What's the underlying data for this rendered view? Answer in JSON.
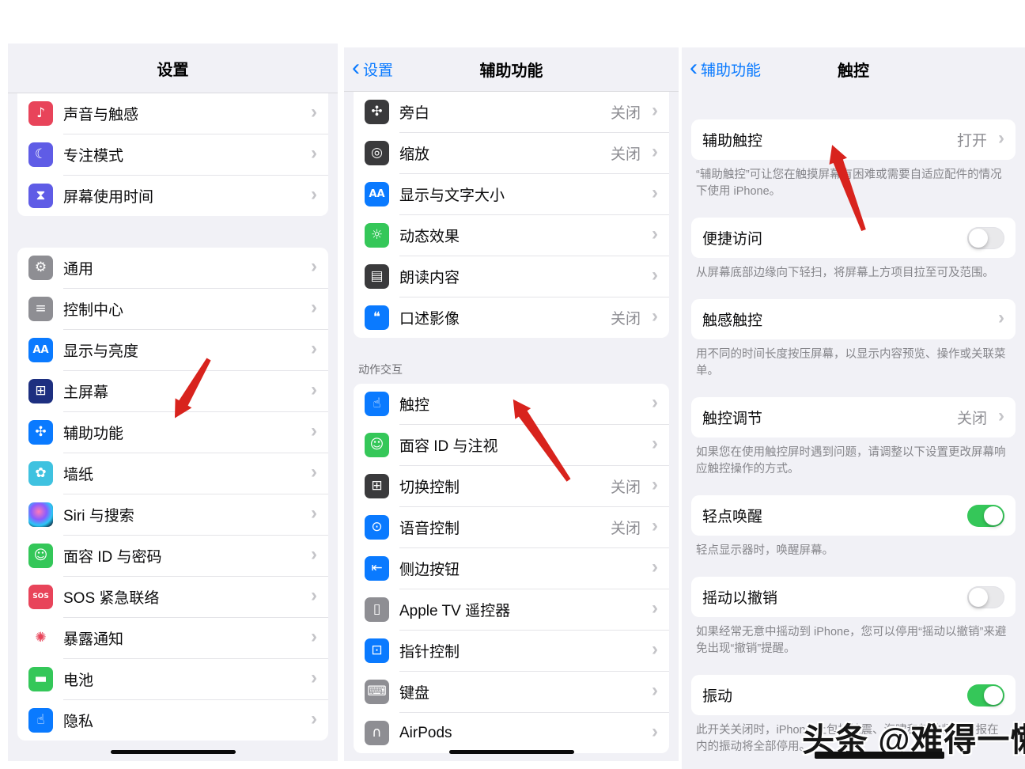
{
  "watermark": {
    "text": "头条 @难得一懒"
  },
  "colors": {
    "accent_blue": "#0a7aff",
    "toggle_on": "#35c759",
    "toggle_off": "#e9e9eb",
    "arrow_red": "#d8231d",
    "panel_bg": "#f1f1f6",
    "card_bg": "#ffffff",
    "value_gray": "#8e8e93"
  },
  "panels": [
    {
      "name": "settings-root",
      "header": {
        "title": "设置"
      },
      "home_indicator": true,
      "sections": [
        {
          "kind": "group",
          "flush": true,
          "items": [
            {
              "name": "sound-haptics",
              "label": "声音与触感",
              "chevron": true,
              "icon": {
                "name": "speaker-icon",
                "glyph": "♪",
                "bg": "#e8445a"
              }
            },
            {
              "name": "focus-mode",
              "label": "专注模式",
              "chevron": true,
              "icon": {
                "name": "moon-icon",
                "glyph": "☾",
                "bg": "#5f5ce6"
              }
            },
            {
              "name": "screen-time",
              "label": "屏幕使用时间",
              "chevron": true,
              "icon": {
                "name": "hourglass-icon",
                "glyph": "⧗",
                "bg": "#5f5ce6"
              }
            }
          ]
        },
        {
          "kind": "group",
          "items": [
            {
              "name": "general",
              "label": "通用",
              "chevron": true,
              "icon": {
                "name": "gear-icon",
                "glyph": "⚙",
                "bg": "#8e8e93"
              }
            },
            {
              "name": "control-center",
              "label": "控制中心",
              "chevron": true,
              "icon": {
                "name": "toggles-icon",
                "glyph": "≡",
                "bg": "#8e8e93"
              }
            },
            {
              "name": "display-brightness",
              "label": "显示与亮度",
              "chevron": true,
              "icon": {
                "name": "text-size-icon",
                "glyph": "AA",
                "bg": "#0a7aff"
              }
            },
            {
              "name": "home-screen",
              "label": "主屏幕",
              "chevron": true,
              "icon": {
                "name": "grid-icon",
                "glyph": "⊞",
                "bg": "#1d2f80"
              }
            },
            {
              "name": "accessibility",
              "label": "辅助功能",
              "chevron": true,
              "icon": {
                "name": "accessibility-icon",
                "glyph": "✣",
                "bg": "#0a7aff"
              }
            },
            {
              "name": "wallpaper",
              "label": "墙纸",
              "chevron": true,
              "icon": {
                "name": "flower-icon",
                "glyph": "✿",
                "bg": "#3fc2e0"
              }
            },
            {
              "name": "siri-search",
              "label": "Siri 与搜索",
              "chevron": true,
              "icon": {
                "name": "siri-icon",
                "glyph": "",
                "style": "siri"
              }
            },
            {
              "name": "face-id-passcode",
              "label": "面容 ID 与密码",
              "chevron": true,
              "icon": {
                "name": "face-id-icon",
                "glyph": "☺",
                "bg": "#34c759"
              }
            },
            {
              "name": "sos-emergency",
              "label": "SOS 紧急联络",
              "chevron": true,
              "icon": {
                "name": "sos-icon",
                "glyph": "SOS",
                "bg": "#e8445a"
              }
            },
            {
              "name": "exposure-notifications",
              "label": "暴露通知",
              "chevron": true,
              "icon": {
                "name": "exposure-icon",
                "glyph": "✺",
                "bg": "#ffffff",
                "fg": "#e8445a"
              }
            },
            {
              "name": "battery",
              "label": "电池",
              "chevron": true,
              "icon": {
                "name": "battery-icon",
                "glyph": "▬",
                "bg": "#34c759"
              }
            },
            {
              "name": "privacy",
              "label": "隐私",
              "chevron": true,
              "icon": {
                "name": "hand-icon",
                "glyph": "☝",
                "bg": "#0a7aff"
              }
            }
          ]
        }
      ]
    },
    {
      "name": "accessibility-page",
      "header": {
        "back": "设置",
        "title": "辅助功能"
      },
      "home_indicator": true,
      "sections": [
        {
          "kind": "group",
          "flush": true,
          "items": [
            {
              "name": "voiceover",
              "label": "旁白",
              "value": "关闭",
              "chevron": true,
              "icon": {
                "name": "voiceover-icon",
                "glyph": "✣",
                "bg": "#3a3a3c"
              }
            },
            {
              "name": "zoom",
              "label": "缩放",
              "value": "关闭",
              "chevron": true,
              "icon": {
                "name": "zoom-icon",
                "glyph": "◎",
                "bg": "#3a3a3c"
              }
            },
            {
              "name": "display-text-size",
              "label": "显示与文字大小",
              "chevron": true,
              "icon": {
                "name": "text-size-icon",
                "glyph": "AA",
                "bg": "#0a7aff"
              }
            },
            {
              "name": "motion",
              "label": "动态效果",
              "chevron": true,
              "icon": {
                "name": "motion-icon",
                "glyph": "☼",
                "bg": "#35c759"
              }
            },
            {
              "name": "spoken-content",
              "label": "朗读内容",
              "chevron": true,
              "icon": {
                "name": "speech-bubble-icon",
                "glyph": "▤",
                "bg": "#3a3a3c"
              }
            },
            {
              "name": "audio-descriptions",
              "label": "口述影像",
              "value": "关闭",
              "chevron": true,
              "icon": {
                "name": "quote-bubble-icon",
                "glyph": "❝",
                "bg": "#0a7aff"
              }
            }
          ]
        },
        {
          "kind": "label",
          "text": "动作交互"
        },
        {
          "kind": "group",
          "items": [
            {
              "name": "touch",
              "label": "触控",
              "chevron": true,
              "icon": {
                "name": "touch-hand-icon",
                "glyph": "☝",
                "bg": "#0a7aff"
              }
            },
            {
              "name": "face-id-attention",
              "label": "面容 ID 与注视",
              "chevron": true,
              "icon": {
                "name": "face-id-icon",
                "glyph": "☺",
                "bg": "#35c759"
              }
            },
            {
              "name": "switch-control",
              "label": "切换控制",
              "value": "关闭",
              "chevron": true,
              "icon": {
                "name": "switch-grid-icon",
                "glyph": "⊞",
                "bg": "#3a3a3c"
              }
            },
            {
              "name": "voice-control",
              "label": "语音控制",
              "value": "关闭",
              "chevron": true,
              "icon": {
                "name": "voice-face-icon",
                "glyph": "⊙",
                "bg": "#0a7aff"
              }
            },
            {
              "name": "side-button",
              "label": "侧边按钮",
              "chevron": true,
              "icon": {
                "name": "side-button-icon",
                "glyph": "⇤",
                "bg": "#0a7aff"
              }
            },
            {
              "name": "apple-tv-remote",
              "label": "Apple TV 遥控器",
              "chevron": true,
              "icon": {
                "name": "remote-icon",
                "glyph": "▯",
                "bg": "#8e8e93"
              }
            },
            {
              "name": "pointer-control",
              "label": "指针控制",
              "chevron": true,
              "icon": {
                "name": "pointer-icon",
                "glyph": "⊡",
                "bg": "#0a7aff"
              }
            },
            {
              "name": "keyboard",
              "label": "键盘",
              "chevron": true,
              "icon": {
                "name": "keyboard-icon",
                "glyph": "⌨",
                "bg": "#8e8e93"
              }
            },
            {
              "name": "airpods",
              "label": "AirPods",
              "chevron": true,
              "icon": {
                "name": "headphones-icon",
                "glyph": "∩",
                "bg": "#8e8e93"
              }
            }
          ]
        }
      ]
    },
    {
      "name": "touch-page",
      "header": {
        "back": "辅助功能",
        "title": "触控"
      },
      "home_indicator": false,
      "sections": [
        {
          "kind": "group",
          "items": [
            {
              "name": "assistivetouch",
              "label": "辅助触控",
              "value": "打开",
              "chevron": true
            }
          ]
        },
        {
          "kind": "footer",
          "text": "“辅助触控”可让您在触摸屏幕有困难或需要自适应配件的情况下使用 iPhone。"
        },
        {
          "kind": "group",
          "items": [
            {
              "name": "reachability",
              "label": "便捷访问",
              "toggle": "off"
            }
          ]
        },
        {
          "kind": "footer",
          "text": "从屏幕底部边缘向下轻扫，将屏幕上方项目拉至可及范围。"
        },
        {
          "kind": "group",
          "items": [
            {
              "name": "haptic-touch",
              "label": "触感触控",
              "chevron": true
            }
          ]
        },
        {
          "kind": "footer",
          "text": "用不同的时间长度按压屏幕，以显示内容预览、操作或关联菜单。"
        },
        {
          "kind": "group",
          "items": [
            {
              "name": "touch-accommodations",
              "label": "触控调节",
              "value": "关闭",
              "chevron": true
            }
          ]
        },
        {
          "kind": "footer",
          "text": "如果您在使用触控屏时遇到问题，请调整以下设置更改屏幕响应触控操作的方式。"
        },
        {
          "kind": "group",
          "items": [
            {
              "name": "tap-to-wake",
              "label": "轻点唤醒",
              "toggle": "on"
            }
          ]
        },
        {
          "kind": "footer",
          "text": "轻点显示器时，唤醒屏幕。"
        },
        {
          "kind": "group",
          "items": [
            {
              "name": "shake-to-undo",
              "label": "摇动以撤销",
              "toggle": "off"
            }
          ]
        },
        {
          "kind": "footer",
          "text": "如果经常无意中摇动到 iPhone，您可以停用“摇动以撤销”来避免出现“撤销”提醒。"
        },
        {
          "kind": "group",
          "items": [
            {
              "name": "vibration",
              "label": "振动",
              "toggle": "on"
            }
          ]
        },
        {
          "kind": "footer",
          "text": "此开关关闭时，iPhone 上包括地震、海啸和其他紧急警报在内的振动将全部停用。"
        }
      ]
    }
  ]
}
